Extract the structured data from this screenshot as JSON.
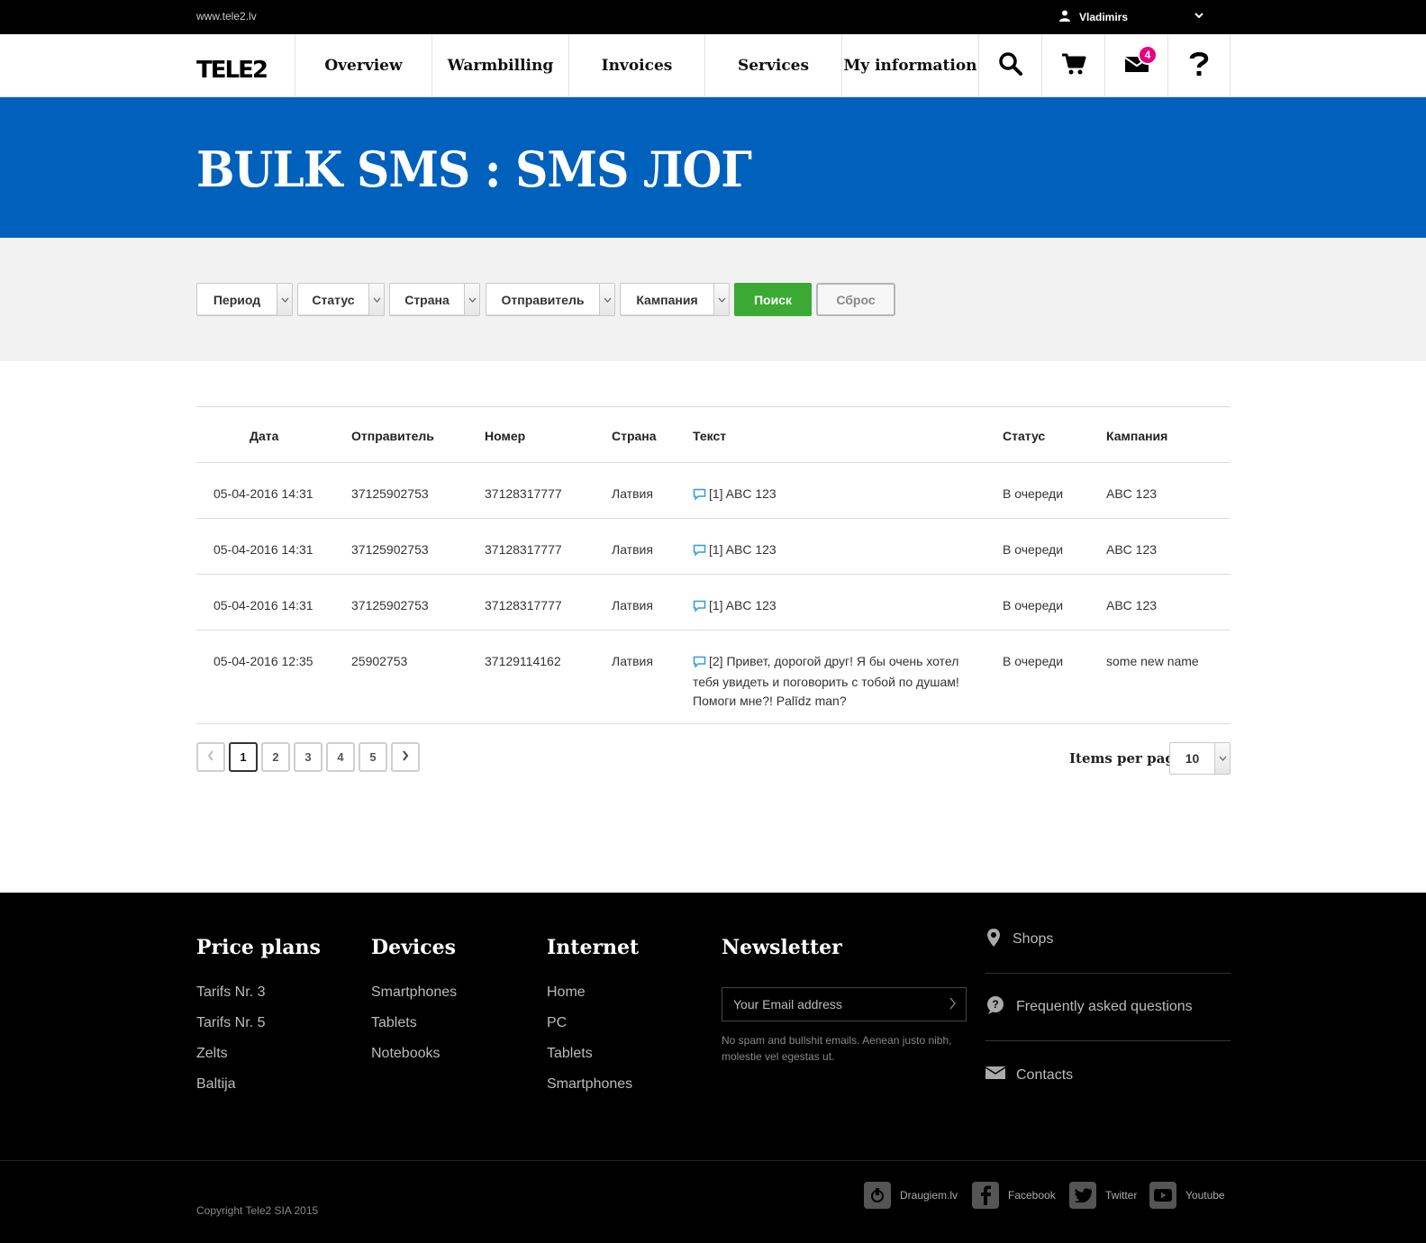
{
  "topbar": {
    "site": "www.tele2.lv",
    "user": "Vladimirs"
  },
  "nav": {
    "logo_text": "TELE2",
    "items": [
      "Overview",
      "Warmbilling",
      "Invoices",
      "Services",
      "My information"
    ],
    "messages_badge": "4",
    "icons": [
      "search-icon",
      "cart-icon",
      "mail-icon",
      "help-icon"
    ]
  },
  "banner": {
    "title": "BULK SMS : SMS ЛОГ"
  },
  "filters": {
    "selects": [
      "Период",
      "Статус",
      "Страна",
      "Отправитель",
      "Кампания"
    ],
    "search_label": "Поиск",
    "reset_label": "Сброс"
  },
  "table": {
    "headers": [
      "Дата",
      "Отправитель",
      "Номер",
      "Страна",
      "Текст",
      "Статус",
      "Кампания"
    ],
    "rows": [
      {
        "date": "05-04-2016 14:31",
        "sender": "37125902753",
        "number": "37128317777",
        "country": "Латвия",
        "text": "[1] ABC 123",
        "status": "В очереди",
        "campaign": "ABC 123"
      },
      {
        "date": "05-04-2016 14:31",
        "sender": "37125902753",
        "number": "37128317777",
        "country": "Латвия",
        "text": "[1] ABC 123",
        "status": "В очереди",
        "campaign": "ABC 123"
      },
      {
        "date": "05-04-2016 14:31",
        "sender": "37125902753",
        "number": "37128317777",
        "country": "Латвия",
        "text": "[1] ABC 123",
        "status": "В очереди",
        "campaign": "ABC 123"
      },
      {
        "date": "05-04-2016 12:35",
        "sender": "25902753",
        "number": "37129114162",
        "country": "Латвия",
        "text": "[2] Привет, дорогой друг! Я бы очень хотел тебя увидеть и поговорить с тобой по душам! Помоги мне?! Palīdz man?",
        "status": "В очереди",
        "campaign": "some new name"
      }
    ]
  },
  "pagination": {
    "pages": [
      "1",
      "2",
      "3",
      "4",
      "5"
    ],
    "current": "1",
    "items_per_page_label": "Items per page",
    "items_per_page": "10"
  },
  "footer": {
    "columns": [
      {
        "title": "Price plans",
        "links": [
          "Tarifs Nr. 3",
          "Tarifs Nr. 5",
          "Zelts",
          "Baltija"
        ]
      },
      {
        "title": "Devices",
        "links": [
          "Smartphones",
          "Tablets",
          "Notebooks"
        ]
      },
      {
        "title": "Internet",
        "links": [
          "Home",
          "PC",
          "Tablets",
          "Smartphones"
        ]
      }
    ],
    "newsletter": {
      "title": "Newsletter",
      "placeholder": "Your Email address",
      "note": "No spam and bullshit emails. Aenean justo nibh, molestie vel egestas ut."
    },
    "links": [
      "Shops",
      "Frequently asked questions",
      "Contacts"
    ],
    "copyright": "Copyright Tele2 SIA 2015",
    "social": [
      "Draugiem.lv",
      "Facebook",
      "Twitter",
      "Youtube"
    ]
  },
  "colors": {
    "brand_blue": "#0061bd",
    "search_green": "#3aaa35",
    "badge_pink": "#e6007e",
    "footer_bg": "#000000"
  }
}
